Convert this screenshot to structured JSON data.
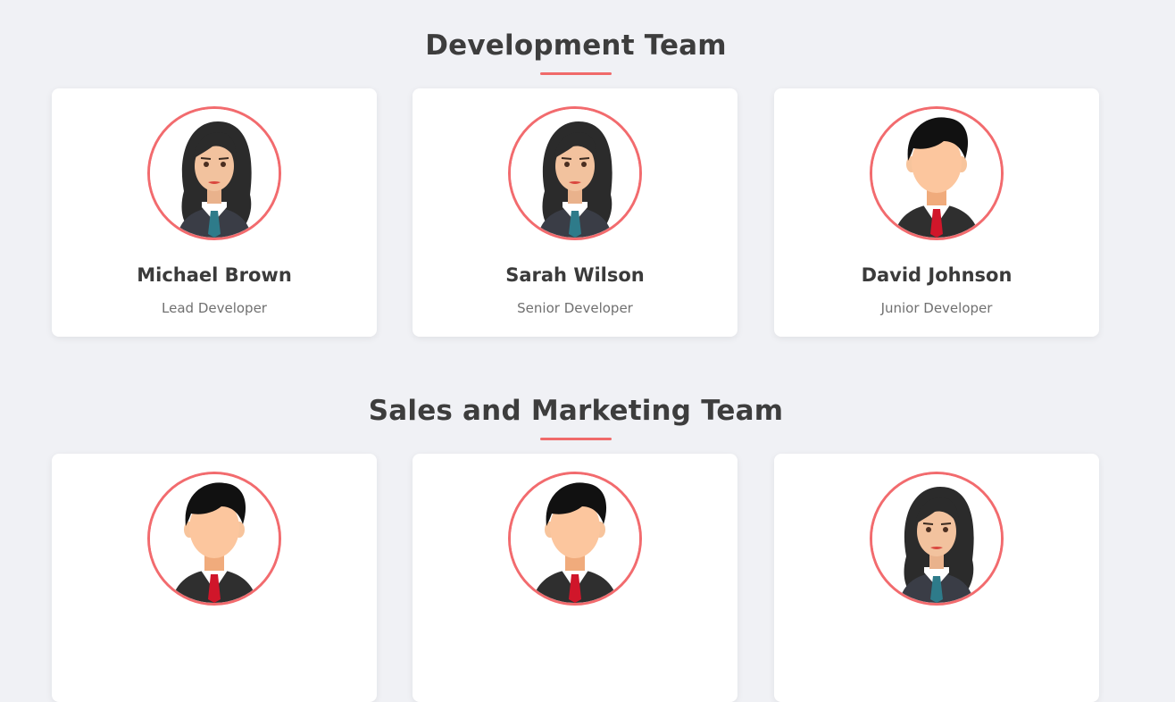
{
  "sections": [
    {
      "title": "Development Team",
      "members": [
        {
          "name": "Michael Brown",
          "role": "Lead Developer",
          "avatar": "female-avatar-icon"
        },
        {
          "name": "Sarah Wilson",
          "role": "Senior Developer",
          "avatar": "female-avatar-icon"
        },
        {
          "name": "David Johnson",
          "role": "Junior Developer",
          "avatar": "male-avatar-icon"
        }
      ]
    },
    {
      "title": "Sales and Marketing Team",
      "members": [
        {
          "avatar": "male-avatar-icon"
        },
        {
          "avatar": "male-avatar-icon"
        },
        {
          "avatar": "female-avatar-icon"
        }
      ]
    }
  ],
  "colors": {
    "background": "#f0f1f5",
    "accent": "#f26b6e",
    "card": "#ffffff",
    "heading": "#3d3d3d",
    "role_text": "#707070"
  }
}
